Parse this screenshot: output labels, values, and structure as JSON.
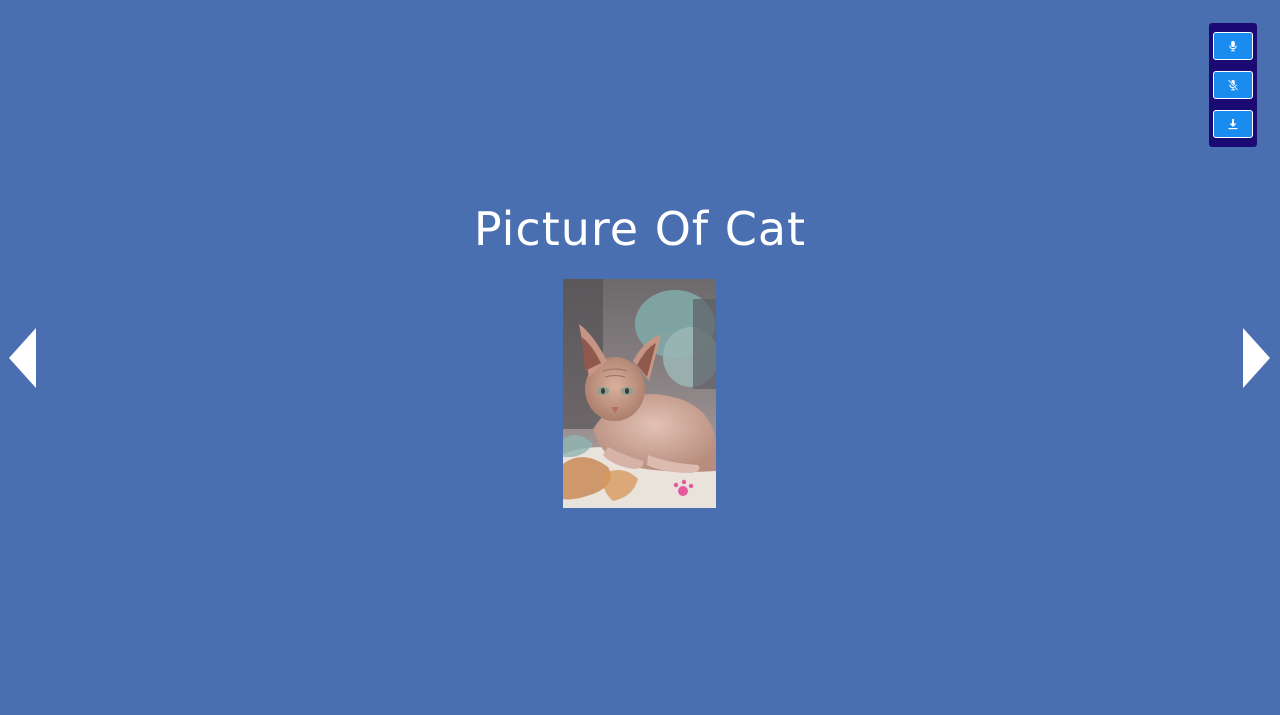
{
  "slide": {
    "title": "Picture Of Cat"
  },
  "colors": {
    "background": "#4a6fb1",
    "panel": "#1b0a73",
    "button": "#1a8cf0",
    "text": "#ffffff"
  },
  "controls": [
    {
      "icon": "microphone-icon"
    },
    {
      "icon": "microphone-off-icon"
    },
    {
      "icon": "download-icon"
    }
  ],
  "navigation": {
    "prev_icon": "arrow-left-icon",
    "next_icon": "arrow-right-icon"
  }
}
